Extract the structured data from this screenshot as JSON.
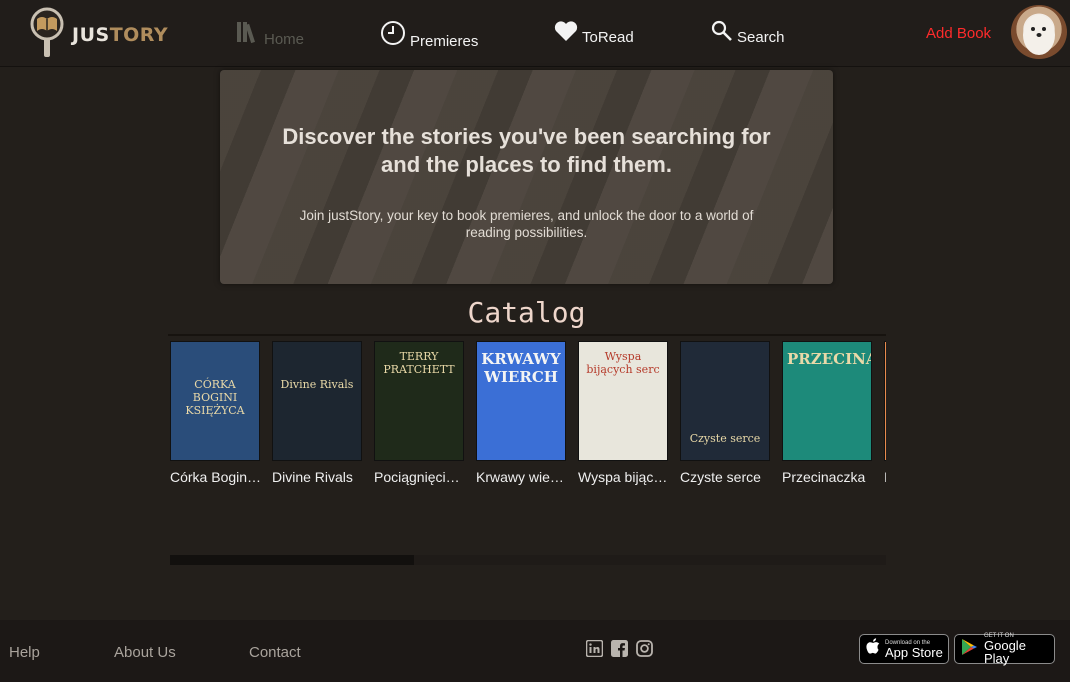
{
  "header": {
    "logo_text_a": "JUS",
    "logo_text_b": "TORY",
    "nav": {
      "home": "Home",
      "premieres": "Premieres",
      "toread": "ToRead",
      "search": "Search"
    },
    "add_book": "Add Book"
  },
  "hero": {
    "title_line1": "Discover the stories you've been searching for",
    "title_line2": "and the places to find them.",
    "subtitle": "Join justStory, your key to book premieres, and unlock the door to a world of reading possibilities."
  },
  "catalog": {
    "title": "Catalog",
    "books": [
      {
        "title": "Córka Bogini Księżyca",
        "cover_text": "CÓRKA BOGINI KSIĘŻYCA",
        "cover_color": "#2a4d7a"
      },
      {
        "title": "Divine Rivals",
        "cover_text": "Divine Rivals",
        "cover_color": "#1d2630"
      },
      {
        "title": "Pociągnięcia pióra",
        "cover_text": "TERRY PRATCHETT",
        "cover_color": "#1f2a1a"
      },
      {
        "title": "Krwawy wierch",
        "cover_text": "KRWAWY WIERCH",
        "cover_color": "#3b6fd6"
      },
      {
        "title": "Wyspa bijących serc",
        "cover_text": "Wyspa bijących serc",
        "cover_color": "#e8e6dc"
      },
      {
        "title": "Czyste serce",
        "cover_text": "Czyste serce",
        "cover_color": "#202a38"
      },
      {
        "title": "Przecinaczka",
        "cover_text": "PRZECINACZKA",
        "cover_color": "#1d8a7a"
      },
      {
        "title": "I",
        "cover_text": "",
        "cover_color": "#e98a4d"
      }
    ]
  },
  "footer": {
    "help": "Help",
    "about": "About Us",
    "contact": "Contact",
    "social_icons": [
      "linkedin-icon",
      "facebook-icon",
      "instagram-icon"
    ],
    "app_store_small": "Download on the",
    "app_store_big": "App Store",
    "google_play_small": "GET IT ON",
    "google_play_big": "Google Play"
  },
  "colors": {
    "background": "#231f1b",
    "accent_red": "#ff2b2b",
    "brand_gold": "#b08d5d"
  }
}
